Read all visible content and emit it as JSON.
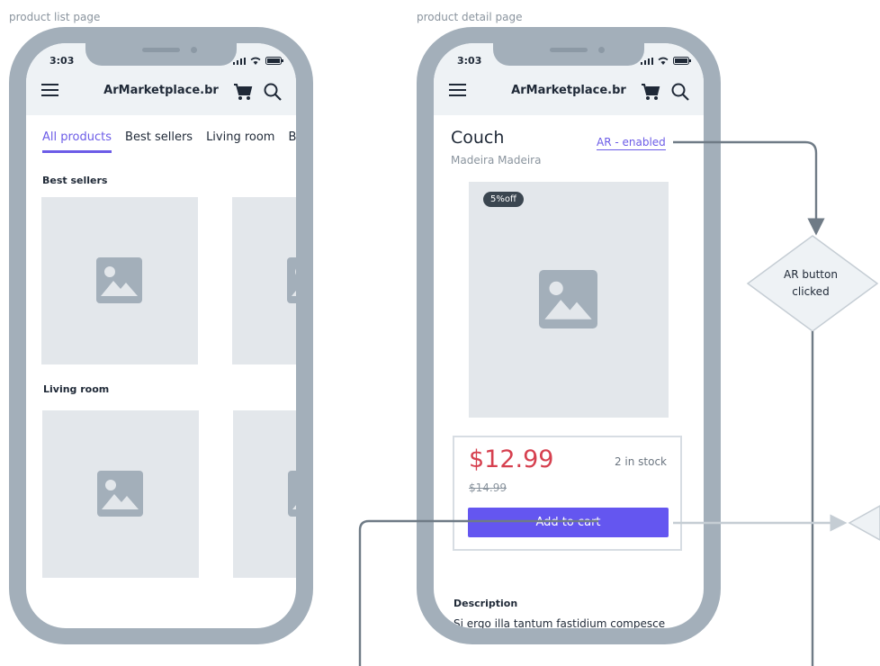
{
  "labels": {
    "list_page": "product list page",
    "detail_page": "product detail page"
  },
  "status_bar": {
    "time": "3:03"
  },
  "app": {
    "brand": "ArMarketplace.br"
  },
  "list_page": {
    "tabs": [
      {
        "label": "All products",
        "active": true
      },
      {
        "label": "Best sellers",
        "active": false
      },
      {
        "label": "Living room",
        "active": false
      },
      {
        "label": "Be",
        "active": false
      }
    ],
    "sections": [
      {
        "title": "Best sellers"
      },
      {
        "title": "Living room"
      }
    ]
  },
  "detail_page": {
    "title": "Couch",
    "brand": "Madeira Madeira",
    "ar_link": "AR - enabled",
    "discount_badge": "5%off",
    "price": "$12.99",
    "old_price": "$14.99",
    "stock": "2 in stock",
    "add_to_cart": "Add to cart",
    "description_title": "Description",
    "description_text": "Si ergo illa tantum fastidium compesce"
  },
  "flow": {
    "decision_label": "AR button clicked"
  },
  "colors": {
    "accent": "#6c5ce7",
    "button": "#6456f0",
    "price": "#d6404f",
    "frame": "#a3afba",
    "placeholder": "#e3e7eb"
  },
  "icons": [
    "menu-icon",
    "cart-icon",
    "search-icon",
    "signal-icon",
    "wifi-icon",
    "battery-icon",
    "image-placeholder-icon"
  ]
}
